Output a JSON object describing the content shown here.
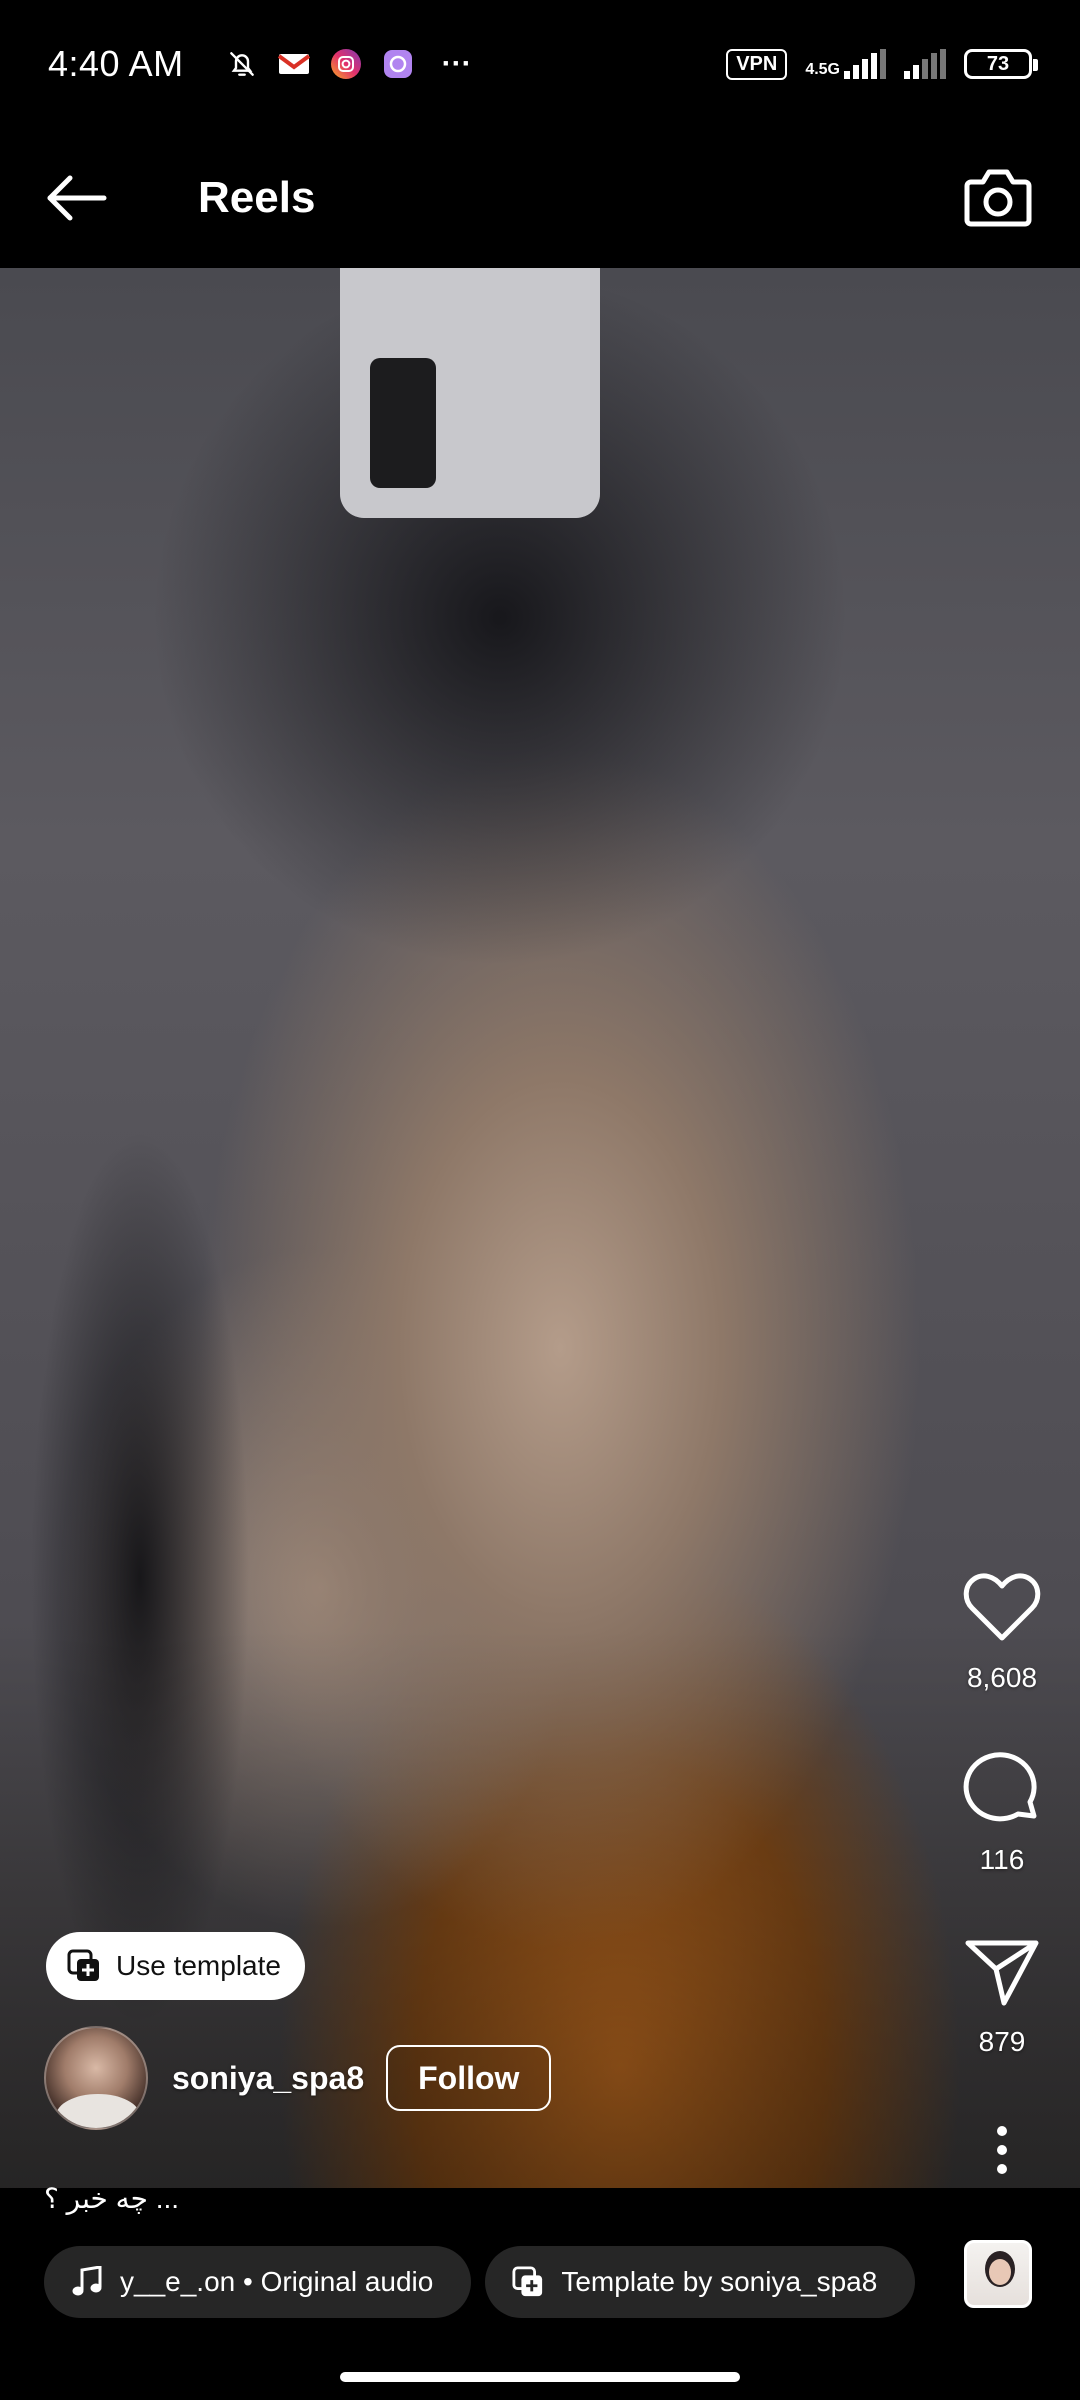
{
  "status_bar": {
    "time": "4:40 AM",
    "notification_icons": [
      "bell-muted-icon",
      "gmail-icon",
      "instagram-icon",
      "app-icon"
    ],
    "more": "···",
    "vpn": "VPN",
    "network": "4.5G",
    "battery": "73"
  },
  "header": {
    "title": "Reels",
    "back_icon": "arrow-left-icon",
    "camera_icon": "camera-icon"
  },
  "reel": {
    "likes": "8,608",
    "comments": "116",
    "shares": "879",
    "use_template_label": "Use template",
    "username": "soniya_spa8",
    "follow_label": "Follow",
    "caption": "چه خبر ؟ ...",
    "audio_label": "y__e_.on • Original audio",
    "template_label": "Template by soniya_spa8"
  },
  "colors": {
    "background": "#000000",
    "chip_background": "#262626",
    "text": "#ffffff"
  }
}
